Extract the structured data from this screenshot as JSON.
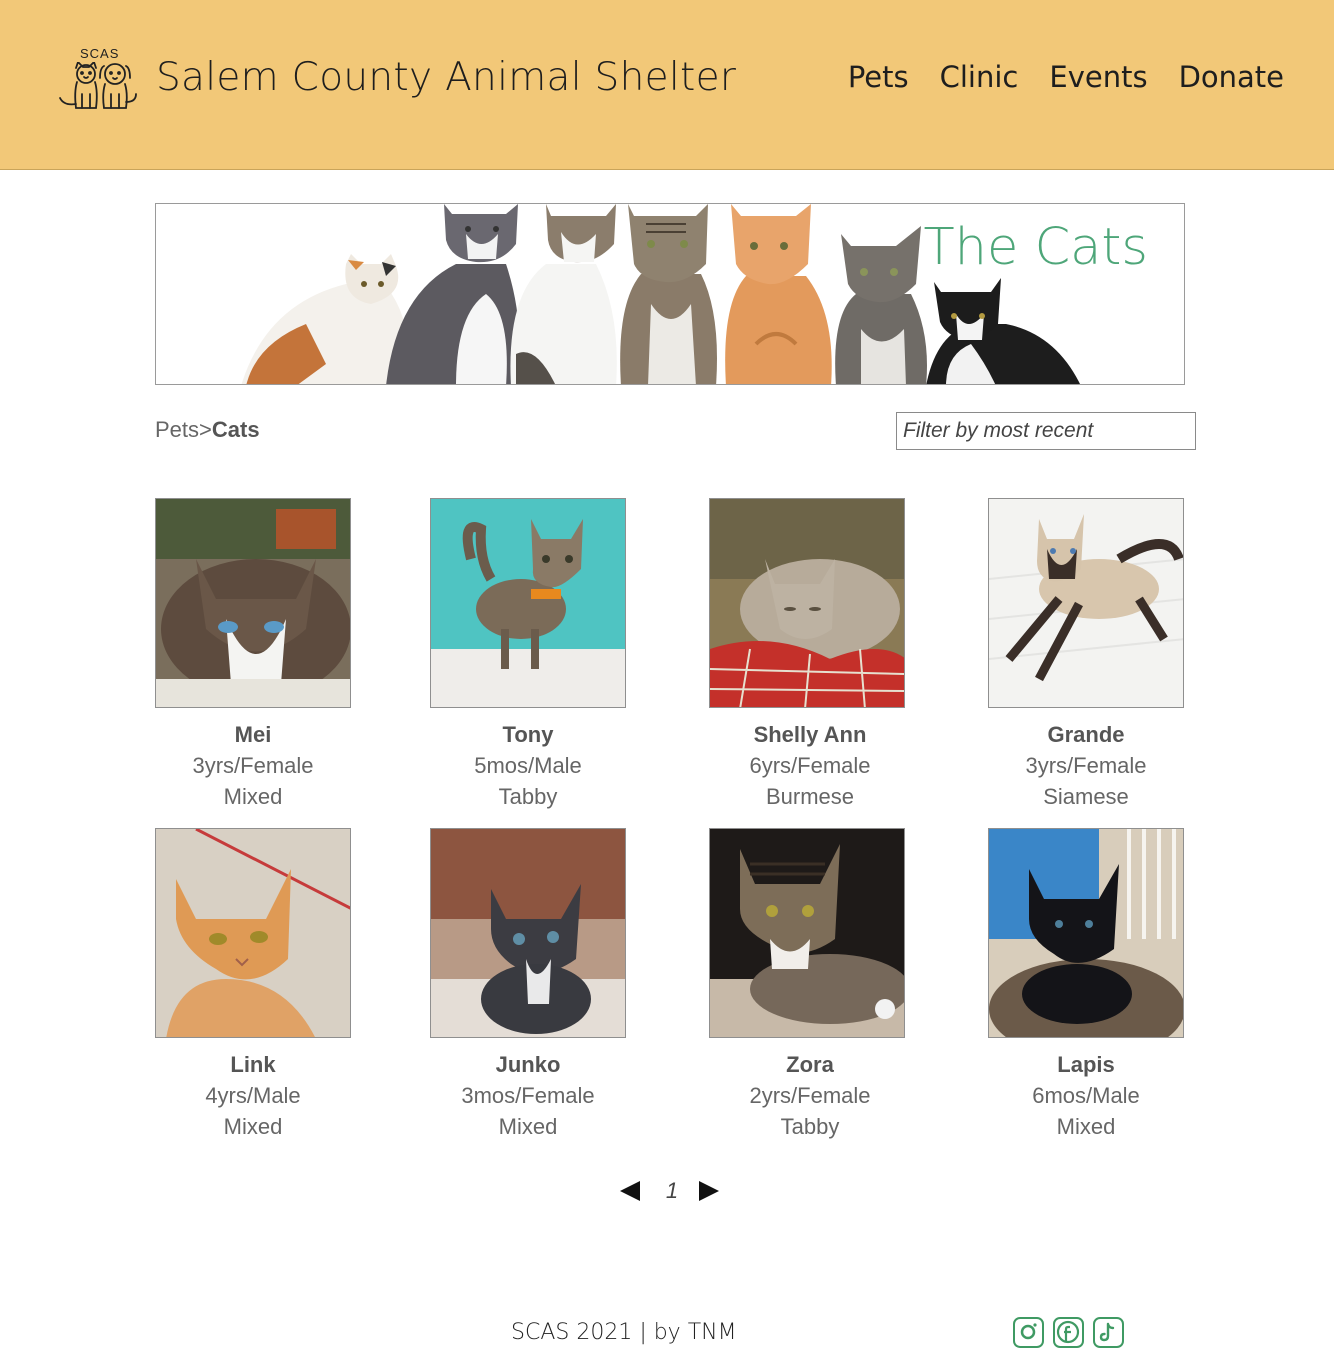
{
  "header": {
    "logo_text": "SCAS",
    "title": "Salem County Animal Shelter",
    "nav": [
      "Pets",
      "Clinic",
      "Events",
      "Donate"
    ],
    "bg_color": "#f2c878"
  },
  "banner": {
    "title": "The Cats",
    "title_color": "#4ea679"
  },
  "breadcrumb": {
    "parent": "Pets",
    "separator": ">",
    "current": "Cats"
  },
  "filter": {
    "placeholder": "Filter by most recent"
  },
  "pets": [
    {
      "name": "Mei",
      "age_sex": "3yrs/Female",
      "breed": "Mixed"
    },
    {
      "name": "Tony",
      "age_sex": "5mos/Male",
      "breed": "Tabby"
    },
    {
      "name": "Shelly Ann",
      "age_sex": "6yrs/Female",
      "breed": "Burmese"
    },
    {
      "name": "Grande",
      "age_sex": "3yrs/Female",
      "breed": "Siamese"
    },
    {
      "name": "Link",
      "age_sex": "4yrs/Male",
      "breed": "Mixed"
    },
    {
      "name": "Junko",
      "age_sex": "3mos/Female",
      "breed": "Mixed"
    },
    {
      "name": "Zora",
      "age_sex": "2yrs/Female",
      "breed": "Tabby"
    },
    {
      "name": "Lapis",
      "age_sex": "6mos/Male",
      "breed": "Mixed"
    }
  ],
  "pagination": {
    "current_page": "1"
  },
  "footer": {
    "text": "SCAS 2021 | by TNM",
    "social_icons": [
      "instagram-icon",
      "facebook-icon",
      "tiktok-icon"
    ],
    "icon_color": "#3f9a63"
  }
}
